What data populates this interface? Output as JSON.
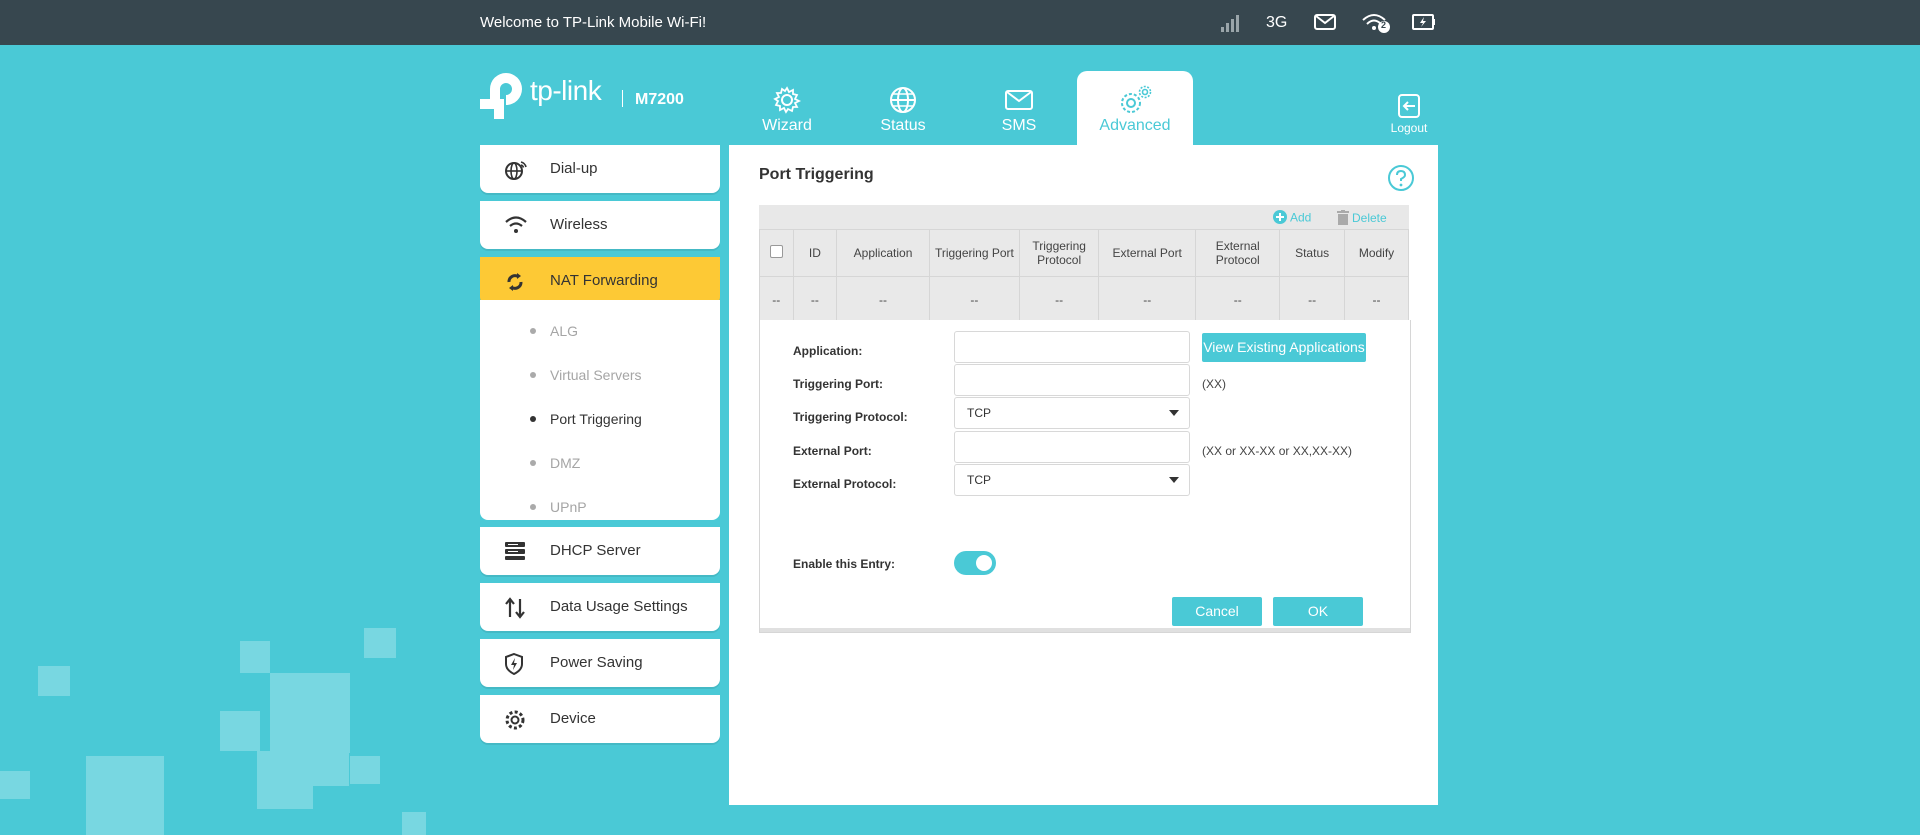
{
  "topbar": {
    "welcome": "Welcome to TP-Link Mobile Wi-Fi!",
    "network_type": "3G",
    "wifi_clients": "2",
    "icons": [
      "signal-icon",
      "mail-icon",
      "wifi-icon",
      "battery-icon"
    ]
  },
  "brand": {
    "logo_text": "tp-link",
    "model": "M7200"
  },
  "nav": {
    "tabs": [
      {
        "label": "Wizard",
        "icon": "gear-icon"
      },
      {
        "label": "Status",
        "icon": "globe-icon"
      },
      {
        "label": "SMS",
        "icon": "envelope-icon"
      },
      {
        "label": "Advanced",
        "icon": "gears-icon",
        "active": true
      }
    ],
    "logout": "Logout"
  },
  "sidebar": {
    "items": [
      {
        "label": "Dial-up",
        "icon": "globe-dial-icon"
      },
      {
        "label": "Wireless",
        "icon": "wifi-icon"
      },
      {
        "label": "NAT Forwarding",
        "icon": "nat-icon",
        "active": true
      },
      {
        "label": "DHCP Server",
        "icon": "server-icon"
      },
      {
        "label": "Data Usage Settings",
        "icon": "arrows-updown-icon"
      },
      {
        "label": "Power Saving",
        "icon": "shield-power-icon"
      },
      {
        "label": "Device",
        "icon": "gear-icon"
      }
    ],
    "subitems": [
      {
        "label": "ALG"
      },
      {
        "label": "Virtual Servers"
      },
      {
        "label": "Port Triggering",
        "active": true
      },
      {
        "label": "DMZ"
      },
      {
        "label": "UPnP"
      }
    ]
  },
  "panel": {
    "title": "Port Triggering",
    "toolbar": {
      "add": "Add",
      "delete": "Delete"
    },
    "table": {
      "headers": [
        "ID",
        "Application",
        "Triggering Port",
        "Triggering Protocol",
        "External Port",
        "External Protocol",
        "Status",
        "Modify"
      ],
      "row": [
        "--",
        "--",
        "--",
        "--",
        "--",
        "--",
        "--",
        "--",
        "--"
      ]
    },
    "form": {
      "application_label": "Application:",
      "application_value": "",
      "view_apps_button": "View Existing Applications",
      "triggering_port_label": "Triggering Port:",
      "triggering_port_value": "",
      "triggering_port_hint": "(XX)",
      "triggering_protocol_label": "Triggering Protocol:",
      "triggering_protocol_value": "TCP",
      "external_port_label": "External Port:",
      "external_port_value": "",
      "external_port_hint": "(XX or XX-XX or XX,XX-XX)",
      "external_protocol_label": "External Protocol:",
      "external_protocol_value": "TCP",
      "enable_label": "Enable this Entry:",
      "enable_on": true,
      "cancel": "Cancel",
      "ok": "OK"
    }
  },
  "colors": {
    "background": "#4ac9d6",
    "topbar": "#37474f",
    "accent": "#4ac9d6",
    "active_menu": "#fdc935"
  }
}
